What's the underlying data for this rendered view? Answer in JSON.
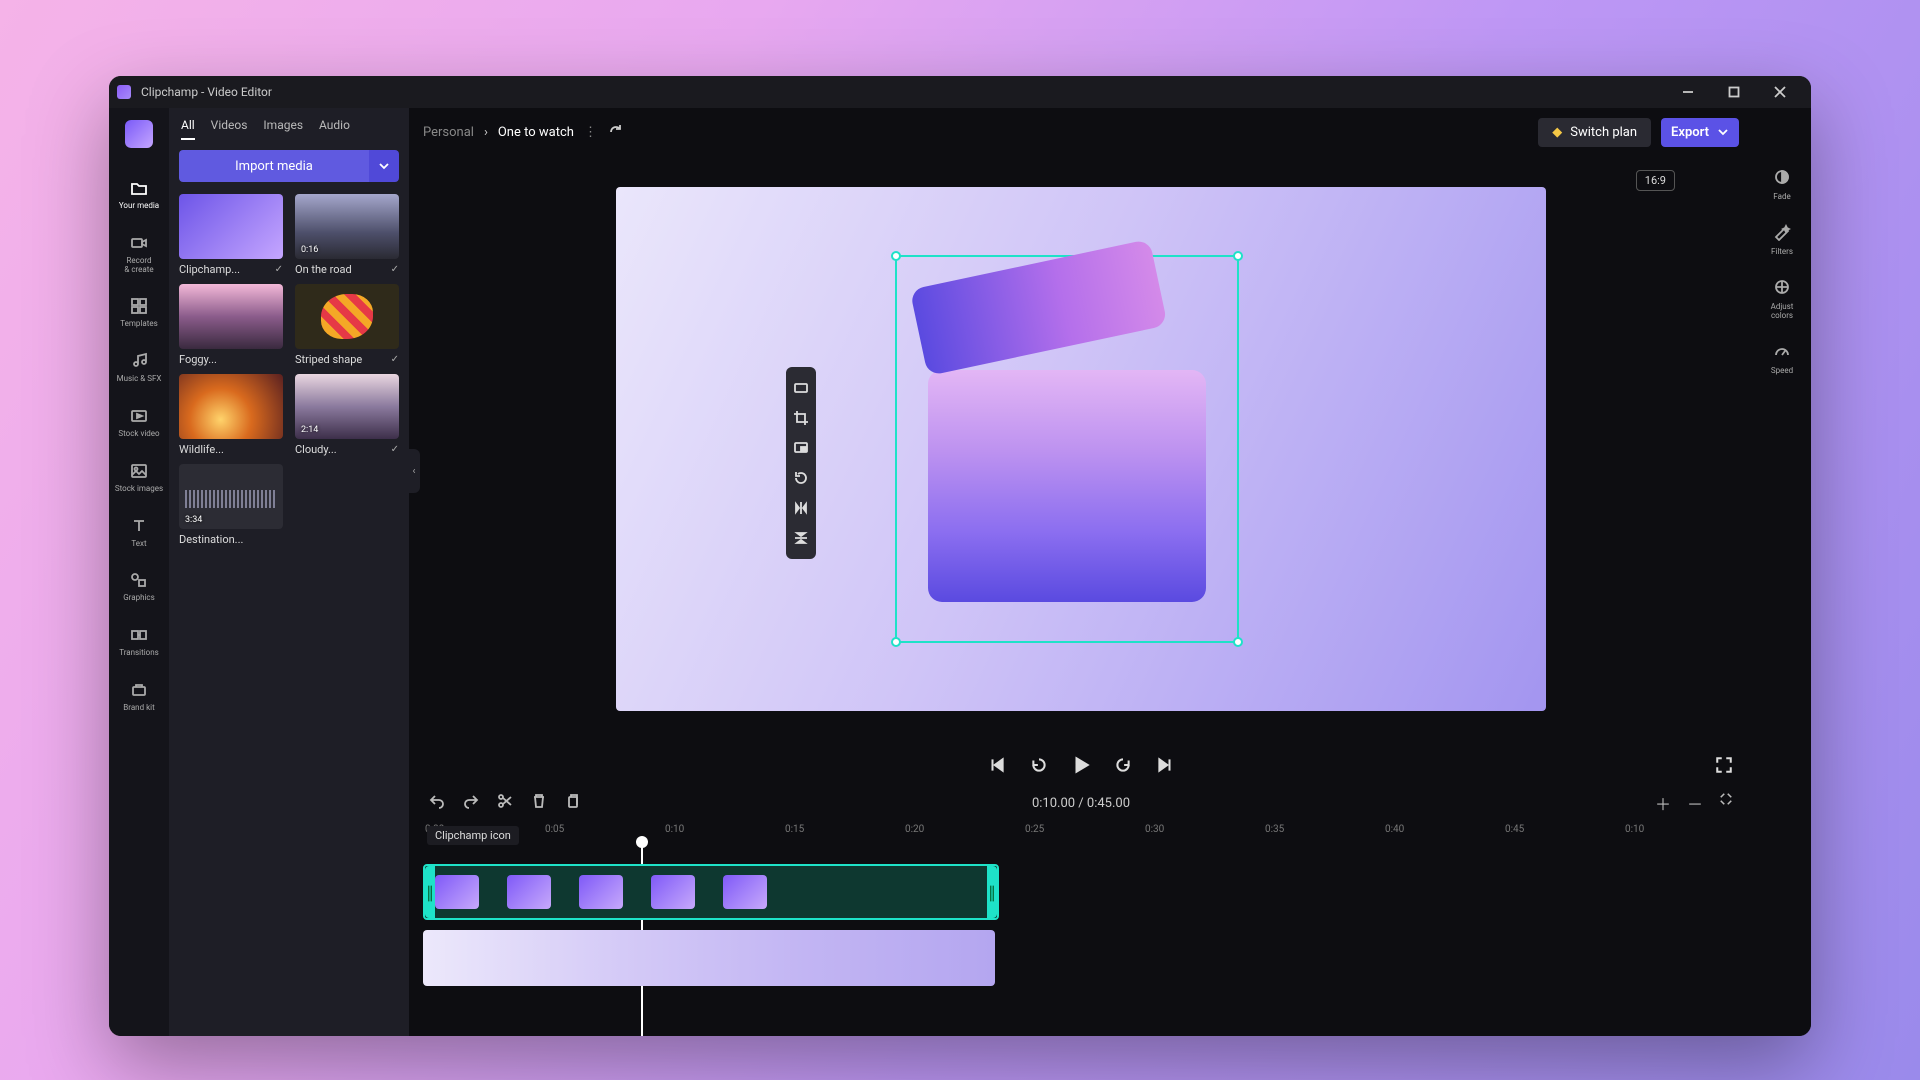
{
  "window": {
    "title": "Clipchamp - Video Editor"
  },
  "leftRail": [
    {
      "id": "your-media",
      "label": "Your media",
      "active": true
    },
    {
      "id": "record",
      "label": "Record\n& create"
    },
    {
      "id": "templates",
      "label": "Templates"
    },
    {
      "id": "music",
      "label": "Music & SFX"
    },
    {
      "id": "stock-video",
      "label": "Stock video"
    },
    {
      "id": "stock-images",
      "label": "Stock images"
    },
    {
      "id": "text",
      "label": "Text"
    },
    {
      "id": "graphics",
      "label": "Graphics"
    },
    {
      "id": "transitions",
      "label": "Transitions"
    },
    {
      "id": "brand",
      "label": "Brand kit"
    }
  ],
  "mediaTabs": {
    "items": [
      "All",
      "Videos",
      "Images",
      "Audio"
    ],
    "active": "All"
  },
  "importButton": {
    "label": "Import media"
  },
  "mediaItems": [
    {
      "name": "Clipchamp...",
      "thumb": "th-logo",
      "checked": true
    },
    {
      "name": "On the road",
      "thumb": "th-road",
      "duration": "0:16",
      "checked": true
    },
    {
      "name": "Foggy...",
      "thumb": "th-foggy"
    },
    {
      "name": "Striped shape",
      "thumb": "th-stripe",
      "checked": true
    },
    {
      "name": "Wildlife...",
      "thumb": "th-wild"
    },
    {
      "name": "Cloudy...",
      "thumb": "th-cloudy",
      "duration": "2:14",
      "checked": true
    },
    {
      "name": "Destination...",
      "thumb": "th-audio",
      "duration": "3:34"
    }
  ],
  "breadcrumb": {
    "root": "Personal",
    "project": "One to watch"
  },
  "topActions": {
    "switchPlan": "Switch plan",
    "export": "Export"
  },
  "aspect": "16:9",
  "rightRail": [
    {
      "id": "fade",
      "label": "Fade"
    },
    {
      "id": "filters",
      "label": "Filters"
    },
    {
      "id": "adjust",
      "label": "Adjust\ncolors"
    },
    {
      "id": "speed",
      "label": "Speed"
    }
  ],
  "timecode": {
    "current": "0:10.00",
    "sep": " / ",
    "total": "0:45.00"
  },
  "timelineClipLabel": "Clipchamp icon",
  "rulerMarks": [
    "0:00",
    "0:05",
    "0:10",
    "0:15",
    "0:20",
    "0:25",
    "0:30",
    "0:35",
    "0:40",
    "0:45",
    "0:10"
  ]
}
